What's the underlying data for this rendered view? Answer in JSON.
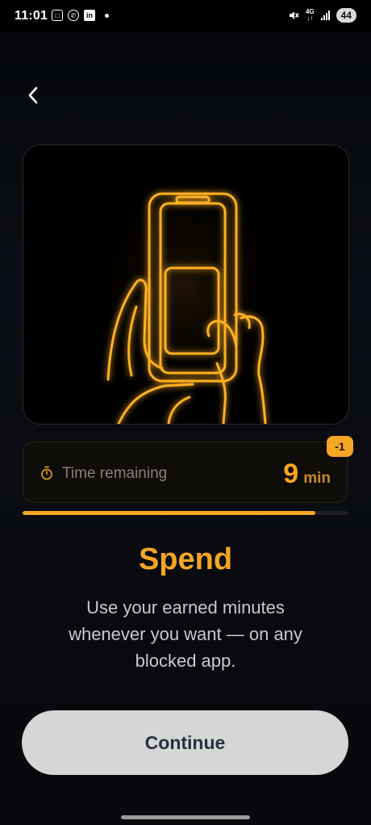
{
  "status_bar": {
    "time": "11:01",
    "left_icons": [
      "screenshot-icon",
      "whatsapp-icon",
      "linkedin-icon"
    ],
    "network_label": "4G",
    "battery": "44"
  },
  "hero": {
    "illustration": "neon-hands-holding-phone"
  },
  "time_card": {
    "label": "Time remaining",
    "value": "9",
    "unit": "min",
    "badge": "-1",
    "progress": 0.9
  },
  "content": {
    "title": "Spend",
    "subtitle": "Use your earned minutes whenever you want — on any blocked app."
  },
  "actions": {
    "continue_label": "Continue"
  },
  "colors": {
    "accent": "#f5a623",
    "background": "#07080b",
    "button": "#d6d6d6"
  }
}
